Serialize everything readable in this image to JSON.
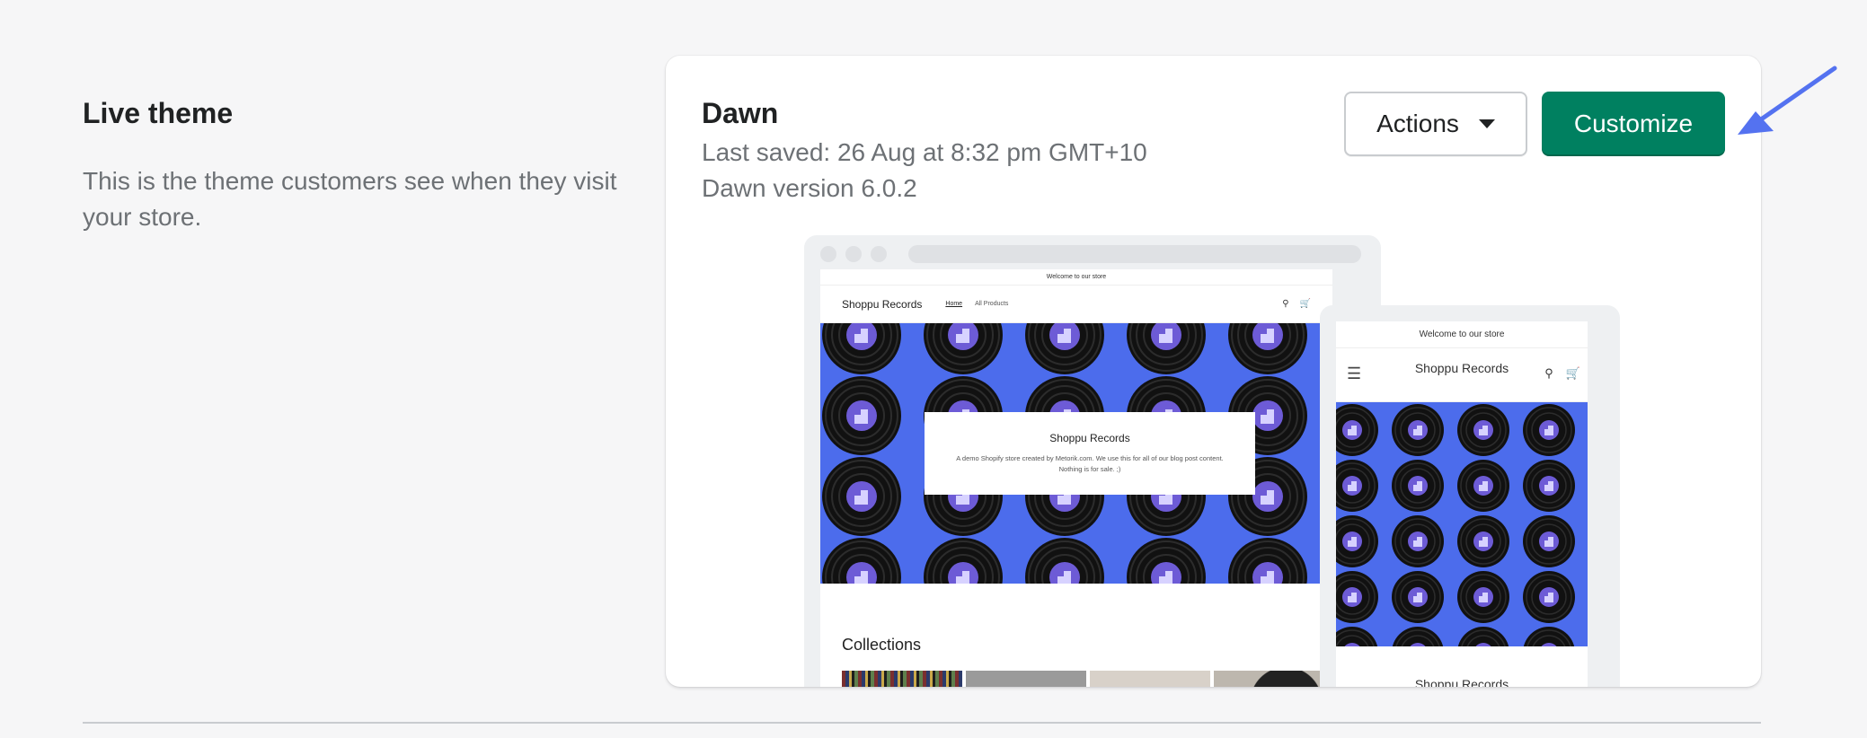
{
  "section": {
    "title": "Live theme",
    "description": "This is the theme customers see when they visit your store."
  },
  "theme": {
    "name": "Dawn",
    "last_saved": "Last saved: 26 Aug at 8:32 pm GMT+10",
    "version": "Dawn version 6.0.2"
  },
  "buttons": {
    "actions_label": "Actions",
    "customize_label": "Customize"
  },
  "preview": {
    "announcement": "Welcome to our store",
    "store_name": "Shoppu Records",
    "nav": [
      "Home",
      "All Products"
    ],
    "hero_title": "Shoppu Records",
    "hero_text": "A demo Shopify store created by Metorik.com. We use this for all of our blog post content. Nothing is for sale. ;)",
    "collections_title": "Collections",
    "mobile_store_name": "Shoppu Records",
    "mobile_hero_title": "Shoppu Records"
  },
  "colors": {
    "primary": "#008060",
    "hero_bg": "#4c6cec",
    "annotation_arrow": "#5472f0"
  }
}
